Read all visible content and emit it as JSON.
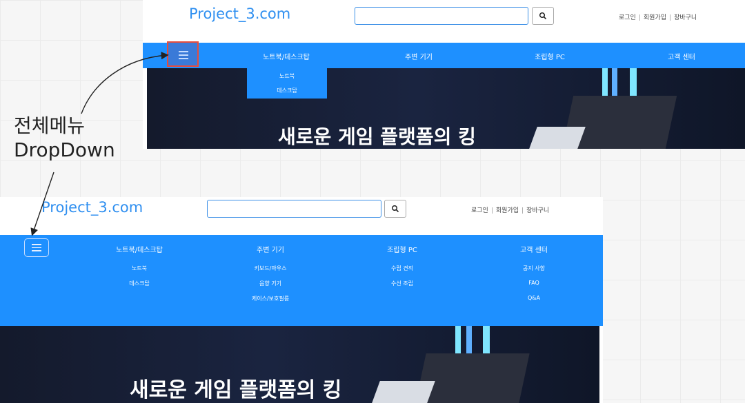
{
  "header": {
    "logo": "Project_3.com",
    "search_placeholder": "",
    "user_links": [
      "로그인",
      "회원가입",
      "장바구니"
    ]
  },
  "nav": {
    "items": [
      "노트북/데스크탑",
      "주변 기기",
      "조립형 PC",
      "고객 센터"
    ]
  },
  "dropdown_single": [
    "노트북",
    "데스크탑"
  ],
  "mega_menu": {
    "columns": [
      [
        "노트북",
        "데스크탑"
      ],
      [
        "키보드/마우스",
        "음향 기기",
        "케이스/보호필름"
      ],
      [
        "수립 견적",
        "수선 조립"
      ],
      [
        "공지 사항",
        "FAQ",
        "Q&A"
      ]
    ]
  },
  "hero": {
    "headline": "새로운 게임 플랫폼의 킹"
  },
  "annotation": {
    "line1": "전체메뉴",
    "line2": "DropDown"
  },
  "colors": {
    "nav_blue": "#1e90ff",
    "logo_blue": "#2f8ff0",
    "highlight_red": "#e74c3c"
  },
  "icons": {
    "menu": "hamburger-menu-icon",
    "search": "search-icon"
  }
}
